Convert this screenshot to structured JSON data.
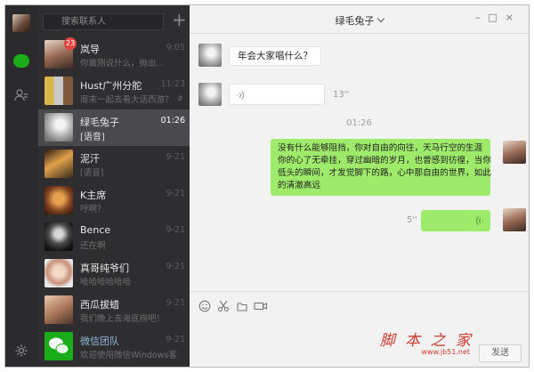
{
  "sidebar": {
    "search_placeholder": "搜索联系人",
    "add_label": "+",
    "conversations": [
      {
        "name": "岚导",
        "preview": "你敢刚说什么，抛出...",
        "time": "9:05",
        "badge": "23"
      },
      {
        "name": "Hust广州分舵",
        "preview": "周末一起去看大话西游？",
        "time": "11:23"
      },
      {
        "name": "绿毛兔子",
        "preview": "[语音]",
        "time": "01:26",
        "active": true
      },
      {
        "name": "泥汗",
        "preview": "[语音]",
        "time": "9-21"
      },
      {
        "name": "K主席",
        "preview": "哼啊？",
        "time": "9-21"
      },
      {
        "name": "Bence",
        "preview": "还在啊",
        "time": "9-21"
      },
      {
        "name": "真哥纯爷们",
        "preview": "哈哈哈哈哈哈",
        "time": "9-21"
      },
      {
        "name": "西瓜拔蜡",
        "preview": "我们晚上去海底捞吧！",
        "time": "9-21"
      },
      {
        "name": "微信团队",
        "preview": "欢迎使用微信Windows客户端",
        "time": "9-21"
      }
    ]
  },
  "chat": {
    "title": "绿毛兔子",
    "messages": [
      {
        "direction": "in",
        "type": "text",
        "text": "年会大家唱什么？"
      },
      {
        "direction": "in",
        "type": "voice",
        "duration": "13''"
      },
      {
        "type": "timestamp",
        "text": "01:26"
      },
      {
        "direction": "out",
        "type": "text",
        "lines": [
          "没有什么能够阻挡，你对自由的向往，天马行空的生涯",
          "你的心了无牵挂，穿过幽暗的岁月，也曾感到彷徨，当你",
          "低头的瞬间，才发觉脚下的路，心中那自由的世界，如此",
          "的清澈高远"
        ]
      },
      {
        "direction": "out",
        "type": "voice",
        "duration": "5''"
      }
    ],
    "send_label": "发送"
  },
  "watermark": {
    "title": "脚 本 之 家",
    "url": "www.jb51.net"
  },
  "colors": {
    "accent_green": "#1aad19",
    "bubble_out": "#9eea6a",
    "badge": "#e64340",
    "sidebar_bg": "#2e2e30",
    "rail_bg": "#2b2b2d"
  }
}
